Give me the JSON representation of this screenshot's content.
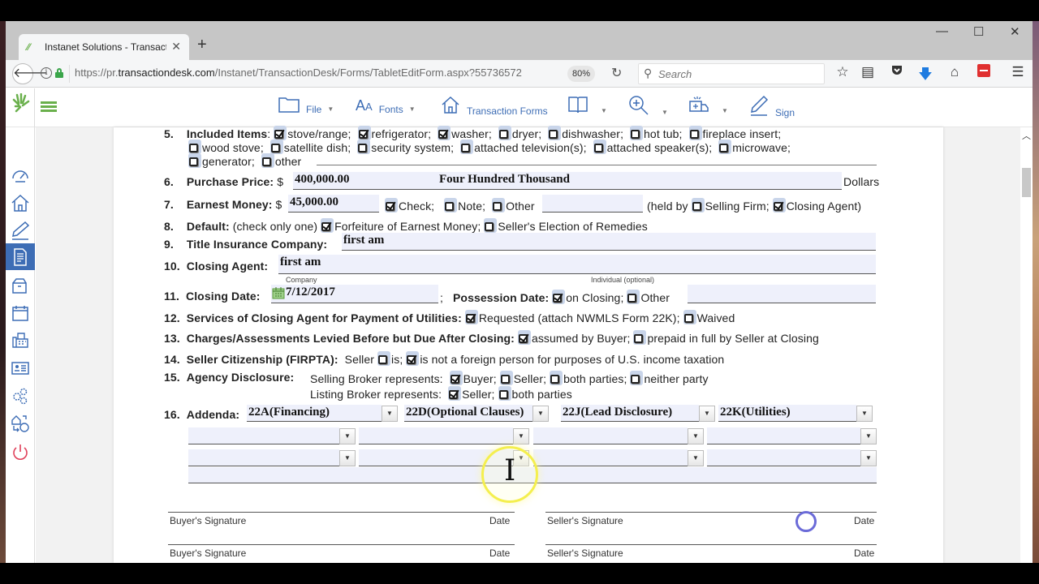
{
  "browser": {
    "tab_title": "Instanet Solutions - Transact",
    "url_prefix": "https://pr.",
    "url_domain": "transactiondesk.com",
    "url_path": "/Instanet/TransactionDesk/Forms/TabletEditForm.aspx?55736572",
    "zoom": "80%",
    "search_placeholder": "Search",
    "window_controls": {
      "minimize": "—",
      "maximize": "☐",
      "close": "✕"
    }
  },
  "toolbar": {
    "file": "File",
    "fonts": "Fonts",
    "transaction_forms": "Transaction Forms",
    "sign": "Sign"
  },
  "sidebar": {
    "items": [
      {
        "name": "dashboard",
        "active": false
      },
      {
        "name": "home",
        "active": false
      },
      {
        "name": "pen",
        "active": false
      },
      {
        "name": "document",
        "active": true
      },
      {
        "name": "package",
        "active": false
      },
      {
        "name": "calendar",
        "active": false
      },
      {
        "name": "fax",
        "active": false
      },
      {
        "name": "contact-card",
        "active": false
      },
      {
        "name": "settings",
        "active": false
      },
      {
        "name": "transfer",
        "active": false
      },
      {
        "name": "power",
        "active": false
      }
    ]
  },
  "form": {
    "item5": {
      "num": "5.",
      "label": "Included Items",
      "options": [
        {
          "label": "stove/range;",
          "checked": true
        },
        {
          "label": "refrigerator;",
          "checked": true
        },
        {
          "label": "washer;",
          "checked": true
        },
        {
          "label": "dryer;",
          "checked": false
        },
        {
          "label": "dishwasher;",
          "checked": false
        },
        {
          "label": "hot tub;",
          "checked": false
        },
        {
          "label": "fireplace insert;",
          "checked": false
        },
        {
          "label": "wood stove;",
          "checked": false
        },
        {
          "label": "satellite dish;",
          "checked": false
        },
        {
          "label": "security system;",
          "checked": false
        },
        {
          "label": "attached television(s);",
          "checked": false
        },
        {
          "label": "attached speaker(s);",
          "checked": false
        },
        {
          "label": "microwave;",
          "checked": false
        },
        {
          "label": "generator;",
          "checked": false
        },
        {
          "label": "other",
          "checked": false
        }
      ]
    },
    "item6": {
      "num": "6.",
      "label": "Purchase Price:",
      "currency": "$",
      "value": "400,000.00",
      "words": "Four Hundred Thousand",
      "suffix": "Dollars"
    },
    "item7": {
      "num": "7.",
      "label": "Earnest Money:",
      "currency": "$",
      "value": "45,000.00",
      "check": {
        "label": "Check;",
        "checked": true
      },
      "note": {
        "label": "Note;",
        "checked": false
      },
      "other": {
        "label": "Other",
        "checked": false
      },
      "held_by": "(held by",
      "selling_firm": {
        "label": "Selling Firm;",
        "checked": false
      },
      "closing_agent": {
        "label": "Closing Agent)",
        "checked": true
      }
    },
    "item8": {
      "num": "8.",
      "label": "Default:",
      "hint": "(check only one)",
      "forfeiture": {
        "label": "Forfeiture of Earnest Money;",
        "checked": true
      },
      "election": {
        "label": "Seller's Election of Remedies",
        "checked": false
      }
    },
    "item9": {
      "num": "9.",
      "label": "Title Insurance Company:",
      "value": "first am"
    },
    "item10": {
      "num": "10.",
      "label": "Closing Agent:",
      "value": "first am",
      "company_caption": "Company",
      "individual_caption": "Individual (optional)"
    },
    "item11": {
      "num": "11.",
      "label": "Closing Date:",
      "value": "7/12/2017",
      "sep": ";",
      "possession_label": "Possession Date:",
      "on_closing": {
        "label": "on Closing;",
        "checked": true
      },
      "other": {
        "label": "Other",
        "checked": false
      }
    },
    "item12": {
      "num": "12.",
      "label": "Services of Closing Agent for Payment of Utilities:",
      "requested": {
        "label": "Requested (attach NWMLS Form 22K);",
        "checked": true
      },
      "waived": {
        "label": "Waived",
        "checked": false
      }
    },
    "item13": {
      "num": "13.",
      "label": "Charges/Assessments Levied Before but Due After Closing:",
      "assumed": {
        "label": "assumed by Buyer;",
        "checked": true
      },
      "prepaid": {
        "label": "prepaid in full by Seller at Closing",
        "checked": false
      }
    },
    "item14": {
      "num": "14.",
      "label": "Seller Citizenship (FIRPTA):",
      "prefix": "Seller",
      "is": {
        "label": "is;",
        "checked": false
      },
      "is_not": {
        "label": "is not a foreign person for purposes of U.S. income taxation",
        "checked": true
      }
    },
    "item15": {
      "num": "15.",
      "label": "Agency Disclosure:",
      "selling_label": "Selling Broker represents:",
      "selling": [
        {
          "label": "Buyer;",
          "checked": true
        },
        {
          "label": "Seller;",
          "checked": false
        },
        {
          "label": "both parties;",
          "checked": false
        },
        {
          "label": "neither party",
          "checked": false
        }
      ],
      "listing_label": "Listing Broker represents:",
      "listing": [
        {
          "label": "Seller;",
          "checked": true
        },
        {
          "label": "both parties",
          "checked": false
        }
      ]
    },
    "item16": {
      "num": "16.",
      "label": "Addenda:",
      "row1": [
        "22A(Financing)",
        "22D(Optional Clauses)",
        "22J(Lead Disclosure)",
        "22K(Utilities)"
      ],
      "row2": [
        "",
        "",
        "",
        ""
      ],
      "row3": [
        "",
        "",
        "",
        ""
      ]
    },
    "signatures": {
      "buyer": "Buyer's Signature",
      "seller": "Seller's Signature",
      "date": "Date"
    }
  }
}
